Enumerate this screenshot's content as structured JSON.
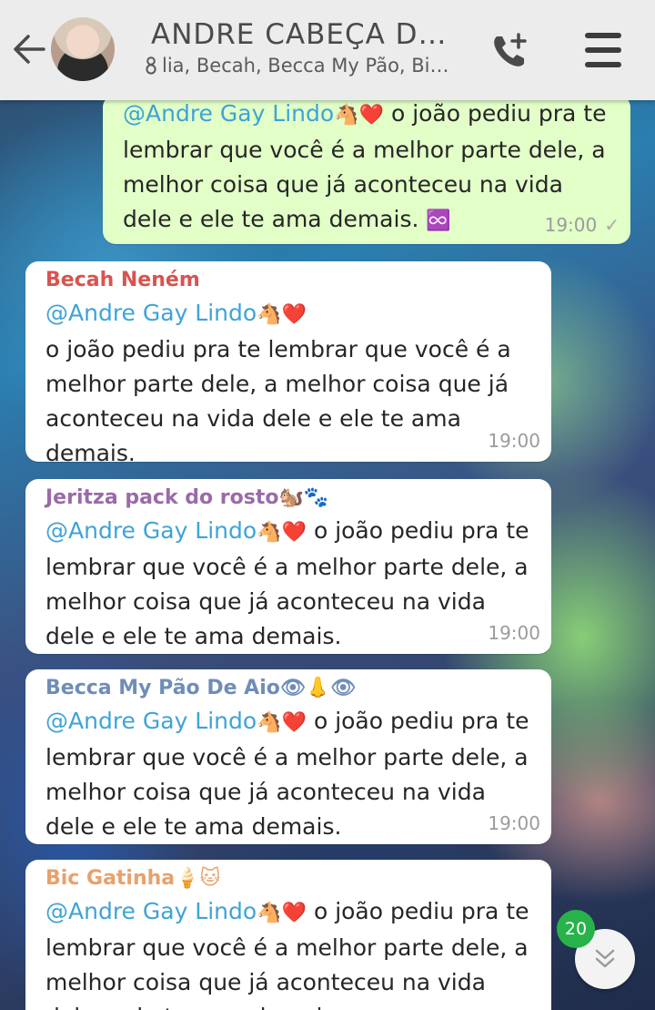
{
  "header": {
    "title": "ANDRE CABEÇA DE...",
    "subtitle": "lia, Becah, Becca My Pão, Bic,..."
  },
  "messages": [
    {
      "outgoing": true,
      "mention": "@Andre Gay Lindo",
      "emoji": "🐴❤️",
      "text": "o joão pediu pra te lembrar que você é a melhor parte dele, a melhor coisa que já aconteceu na vida dele e ele te ama demais.",
      "extra_emoji": "♾️",
      "time": "19:00",
      "check": "✓"
    },
    {
      "sender": "Becah Neném",
      "sender_color": "#d9534f",
      "mention": "@Andre Gay Lindo",
      "emoji": "🐴❤️",
      "text": "o joão pediu pra te lembrar que você é a melhor parte dele, a melhor coisa que já aconteceu na vida dele e ele te ama demais.",
      "time": "19:00"
    },
    {
      "sender": "Jeritza pack do rosto",
      "sender_emoji": "🐿️🐾",
      "sender_color": "#9b6aa8",
      "mention": "@Andre Gay Lindo",
      "emoji": "🐴❤️",
      "text": "o joão pediu pra te lembrar que você é a melhor parte dele, a melhor coisa que já aconteceu na vida dele e ele te ama demais.",
      "time": "19:00"
    },
    {
      "sender": "Becca My Pão De Aio",
      "sender_emoji": "👁👃👁",
      "sender_color": "#6f8db8",
      "mention": "@Andre Gay Lindo",
      "emoji": "🐴❤️",
      "text": "o joão pediu pra te lembrar que você é a melhor parte dele, a melhor coisa que já aconteceu na vida dele e ele te ama demais.",
      "time": "19:00"
    },
    {
      "sender": "Bic Gatinha",
      "sender_emoji": "🍦🐱",
      "sender_color": "#e8a16b",
      "mention": "@Andre Gay Lindo",
      "emoji": "🐴❤️",
      "text": "o joão pediu pra te lembrar que você é a melhor parte dele, a melhor coisa que já aconteceu na vida dele e ele te ama demais.",
      "time": ""
    }
  ],
  "unread_count": "20",
  "colors": {
    "header_bg": "#ececec",
    "outgoing_bubble": "#e2ffc8",
    "incoming_bubble": "#ffffff",
    "mention": "#3fa3d6",
    "badge": "#27b34a"
  }
}
